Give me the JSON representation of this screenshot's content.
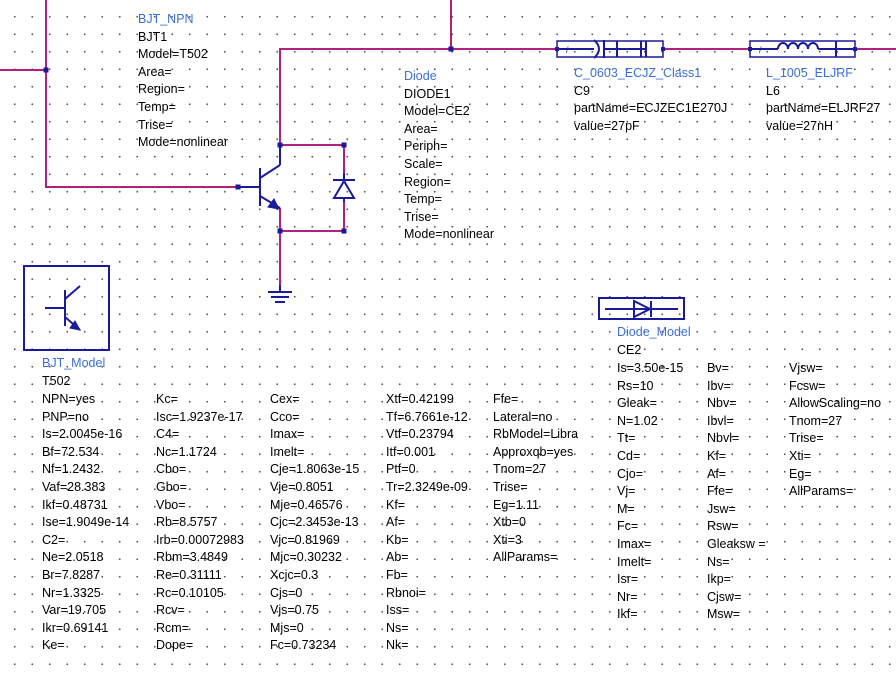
{
  "bjt_instance": {
    "type": "BJT_NPN",
    "name": "BJT1",
    "params": [
      "Model=T502",
      "Area=",
      "Region=",
      "Temp=",
      "Trise=",
      "Mode=nonlinear"
    ]
  },
  "diode_instance": {
    "type": "Diode",
    "name": "DIODE1",
    "params": [
      "Model=CE2",
      "Area=",
      "Periph=",
      "Scale=",
      "Region=",
      "Temp=",
      "Trise=",
      "Mode=nonlinear"
    ]
  },
  "capacitor": {
    "type": "C_0603_ECJZ_Class1",
    "name": "C9",
    "params": [
      "partName=ECJZEC1E270J",
      "value=27pF"
    ]
  },
  "inductor": {
    "type": "L_1005_ELJRF",
    "name": "L6",
    "params": [
      "partName=ELJRF27",
      "value=27nH"
    ]
  },
  "bjt_model": {
    "type": "BJT_Model",
    "name": "T502",
    "columns": [
      [
        "NPN=yes",
        "PNP=no",
        "Is=2.0045e-16",
        "Bf=72.534",
        "Nf=1.2432",
        "Vaf=28.383",
        "Ikf=0.48731",
        "Ise=1.9049e-14",
        "C2=",
        "Ne=2.0518",
        "Br=7.8287",
        "Nr=1.3325",
        "Var=19.705",
        "Ikr=0.69141",
        "Ke="
      ],
      [
        "Kc=",
        "Isc=1.9237e-17",
        "C4=",
        "Nc=1.1724",
        "Cbo=",
        "Gbo=",
        "Vbo=",
        "Rb=8.5757",
        "Irb=0.00072983",
        "Rbm=3.4849",
        "Re=0.31111",
        "Rc=0.10105",
        "Rcv=",
        "Rcm=",
        "Dope="
      ],
      [
        "Cex=",
        "Cco=",
        "Imax=",
        "Imelt=",
        "Cje=1.8063e-15",
        "Vje=0.8051",
        "Mje=0.46576",
        "Cjc=2.3453e-13",
        "Vjc=0.81969",
        "Mjc=0.30232",
        "Xcjc=0.3",
        "Cjs=0",
        "Vjs=0.75",
        "Mjs=0",
        "Fc=0.73234"
      ],
      [
        "Xtf=0.42199",
        "Tf=6.7661e-12",
        "Vtf=0.23794",
        "Itf=0.001",
        "Ptf=0",
        "Tr=2.3249e-09",
        "Kf=",
        "Af=",
        "Kb=",
        "Ab=",
        "Fb=",
        "Rbnoi=",
        "Iss=",
        "Ns=",
        "Nk="
      ],
      [
        "Ffe=",
        "Lateral=no",
        "RbModel=Libra",
        "Approxqb=yes",
        "Tnom=27",
        "Trise=",
        "Eg=1.11",
        "Xtb=0",
        "Xti=3",
        "AllParams="
      ]
    ]
  },
  "diode_model": {
    "type": "Diode_Model",
    "name": "CE2",
    "columns": [
      [
        "Is=3.50e-15",
        "Rs=10",
        "Gleak=",
        "N=1.02",
        "Tt=",
        "Cd=",
        "Cjo=",
        "Vj=",
        "M=",
        "Fc=",
        "Imax=",
        "Imelt=",
        "Isr=",
        "Nr=",
        "Ikf="
      ],
      [
        "Bv=",
        "Ibv=",
        "Nbv=",
        "Ibvl=",
        "Nbvl=",
        "Kf=",
        "Af=",
        "Ffe=",
        "Jsw=",
        "Rsw=",
        "Gleaksw =",
        "Ns=",
        "Ikp=",
        "Cjsw=",
        "Msw="
      ],
      [
        "Vjsw=",
        "Fcsw=",
        "AllowScaling=no",
        "Tnom=27",
        "Trise=",
        "Xti=",
        "Eg=",
        "AllParams="
      ]
    ]
  },
  "colors": {
    "wire": "#b0207c",
    "symbol": "#1a1a9a",
    "component_label": "#3a6fd8",
    "background": "#ffffff"
  }
}
